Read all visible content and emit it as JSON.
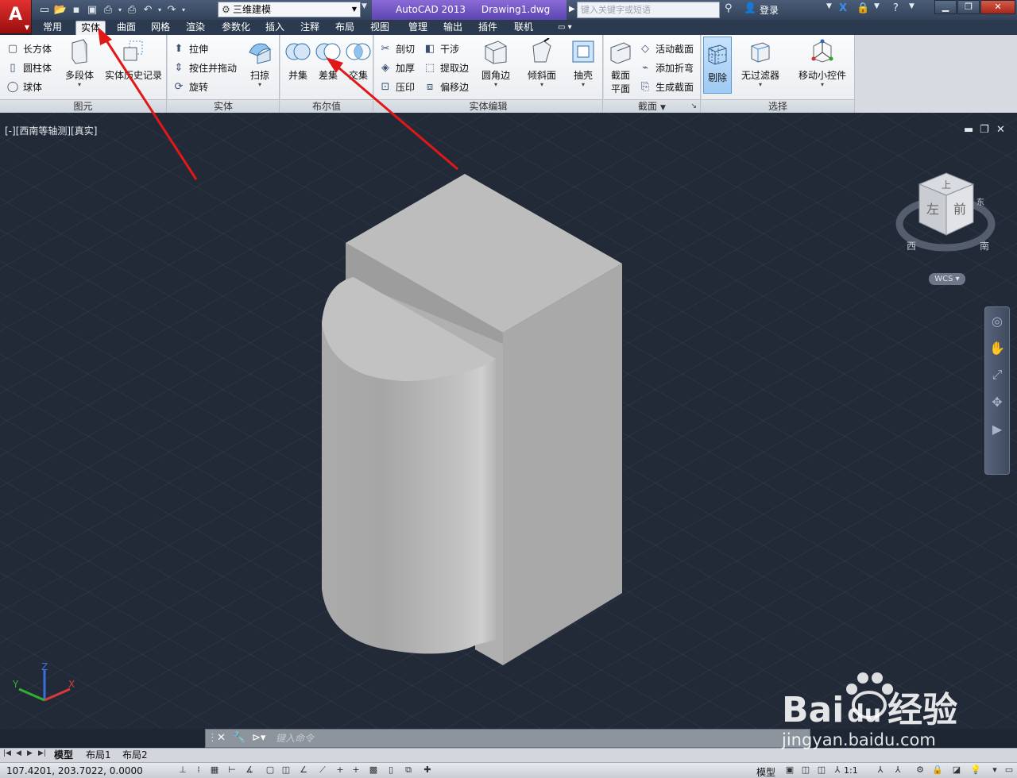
{
  "titlebar": {
    "app_logo": "A",
    "workspace": "三维建模",
    "app_name": "AutoCAD 2013",
    "file_name": "Drawing1.dwg",
    "search_placeholder": "键入关键字或短语",
    "signin": "登录"
  },
  "ribbon_tabs": [
    "常用",
    "实体",
    "曲面",
    "网格",
    "渲染",
    "参数化",
    "插入",
    "注释",
    "布局",
    "视图",
    "管理",
    "输出",
    "插件",
    "联机"
  ],
  "active_tab": "实体",
  "panels": {
    "primitive": {
      "title": "图元",
      "box": "长方体",
      "cylinder": "圆柱体",
      "sphere": "球体",
      "polysolid": "多段体",
      "history": "实体历史记录"
    },
    "solid": {
      "title": "实体",
      "extrude": "拉伸",
      "presspull": "按住并拖动",
      "revolve": "旋转",
      "sweep": "扫掠"
    },
    "boolean": {
      "title": "布尔值",
      "union": "并集",
      "subtract": "差集",
      "intersect": "交集"
    },
    "solid_editing": {
      "title": "实体编辑",
      "slice": "剖切",
      "interfere": "干涉",
      "thicken": "加厚",
      "extract_edges": "提取边",
      "imprint": "压印",
      "offset_edges": "偏移边",
      "fillet_edge": "圆角边",
      "taper_faces": "倾斜面",
      "shell": "抽壳"
    },
    "section": {
      "title": "截面",
      "section_plane_1": "截面",
      "section_plane_2": "平面",
      "live_section": "活动截面",
      "add_jog": "添加折弯",
      "generate_section": "生成截面"
    },
    "selection": {
      "title": "选择",
      "culling": "剔除",
      "no_filter": "无过滤器",
      "gizmo": "移动小控件"
    }
  },
  "viewport": {
    "label": "[-][西南等轴测][真实]",
    "viewcube": {
      "top": "上",
      "left": "左",
      "front": "前",
      "west": "西",
      "south": "南",
      "east": "东"
    },
    "wcs": "WCS",
    "ucs": {
      "x": "X",
      "y": "Y",
      "z": "Z"
    }
  },
  "command_line": {
    "placeholder": "键入命令"
  },
  "layout_tabs": [
    "模型",
    "布局1",
    "布局2"
  ],
  "status": {
    "coords": "107.4201, 203.7022, 0.0000",
    "model": "模型",
    "scale": "1:1"
  },
  "watermark": {
    "brand": "Bai",
    "brand2": "du",
    "brand3": "经验",
    "url": "jingyan.baidu.com"
  },
  "colors": {
    "viewport_bg": "#222a38",
    "solid_face": "#b8b8b8",
    "annotation_arrow": "#e01818",
    "title_accent": "#6a4fc4"
  }
}
